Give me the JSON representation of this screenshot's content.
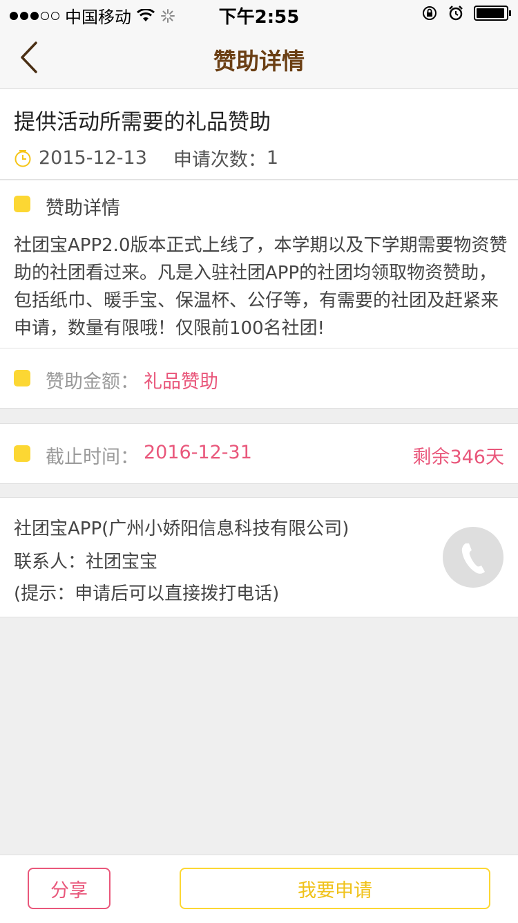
{
  "status_bar": {
    "carrier": "中国移动",
    "time": "下午2:55"
  },
  "nav": {
    "title": "赞助详情"
  },
  "sponsorship": {
    "title": "提供活动所需要的礼品赞助",
    "date": "2015-12-13",
    "apply_count_label": "申请次数：",
    "apply_count": "1"
  },
  "detail": {
    "heading": "赞助详情",
    "body": "社团宝APP2.0版本正式上线了，本学期以及下学期需要物资赞助的社团看过来。凡是入驻社团APP的社团均领取物资赞助，包括纸巾、暖手宝、保温杯、公仔等，有需要的社团及赶紧来申请，数量有限哦！仅限前100名社团!"
  },
  "amount": {
    "label": "赞助金额：",
    "value": "礼品赞助"
  },
  "deadline": {
    "label": "截止时间：",
    "value": "2016-12-31",
    "remaining": "剩余346天"
  },
  "contact": {
    "company": "社团宝APP(广州小娇阳信息科技有限公司)",
    "person": "联系人：社团宝宝",
    "hint": "(提示：申请后可以直接拨打电话)"
  },
  "actions": {
    "share": "分享",
    "apply": "我要申请"
  },
  "colors": {
    "accent_yellow": "#fcd733",
    "accent_pink": "#e9577b",
    "nav_title": "#6b3f14"
  }
}
